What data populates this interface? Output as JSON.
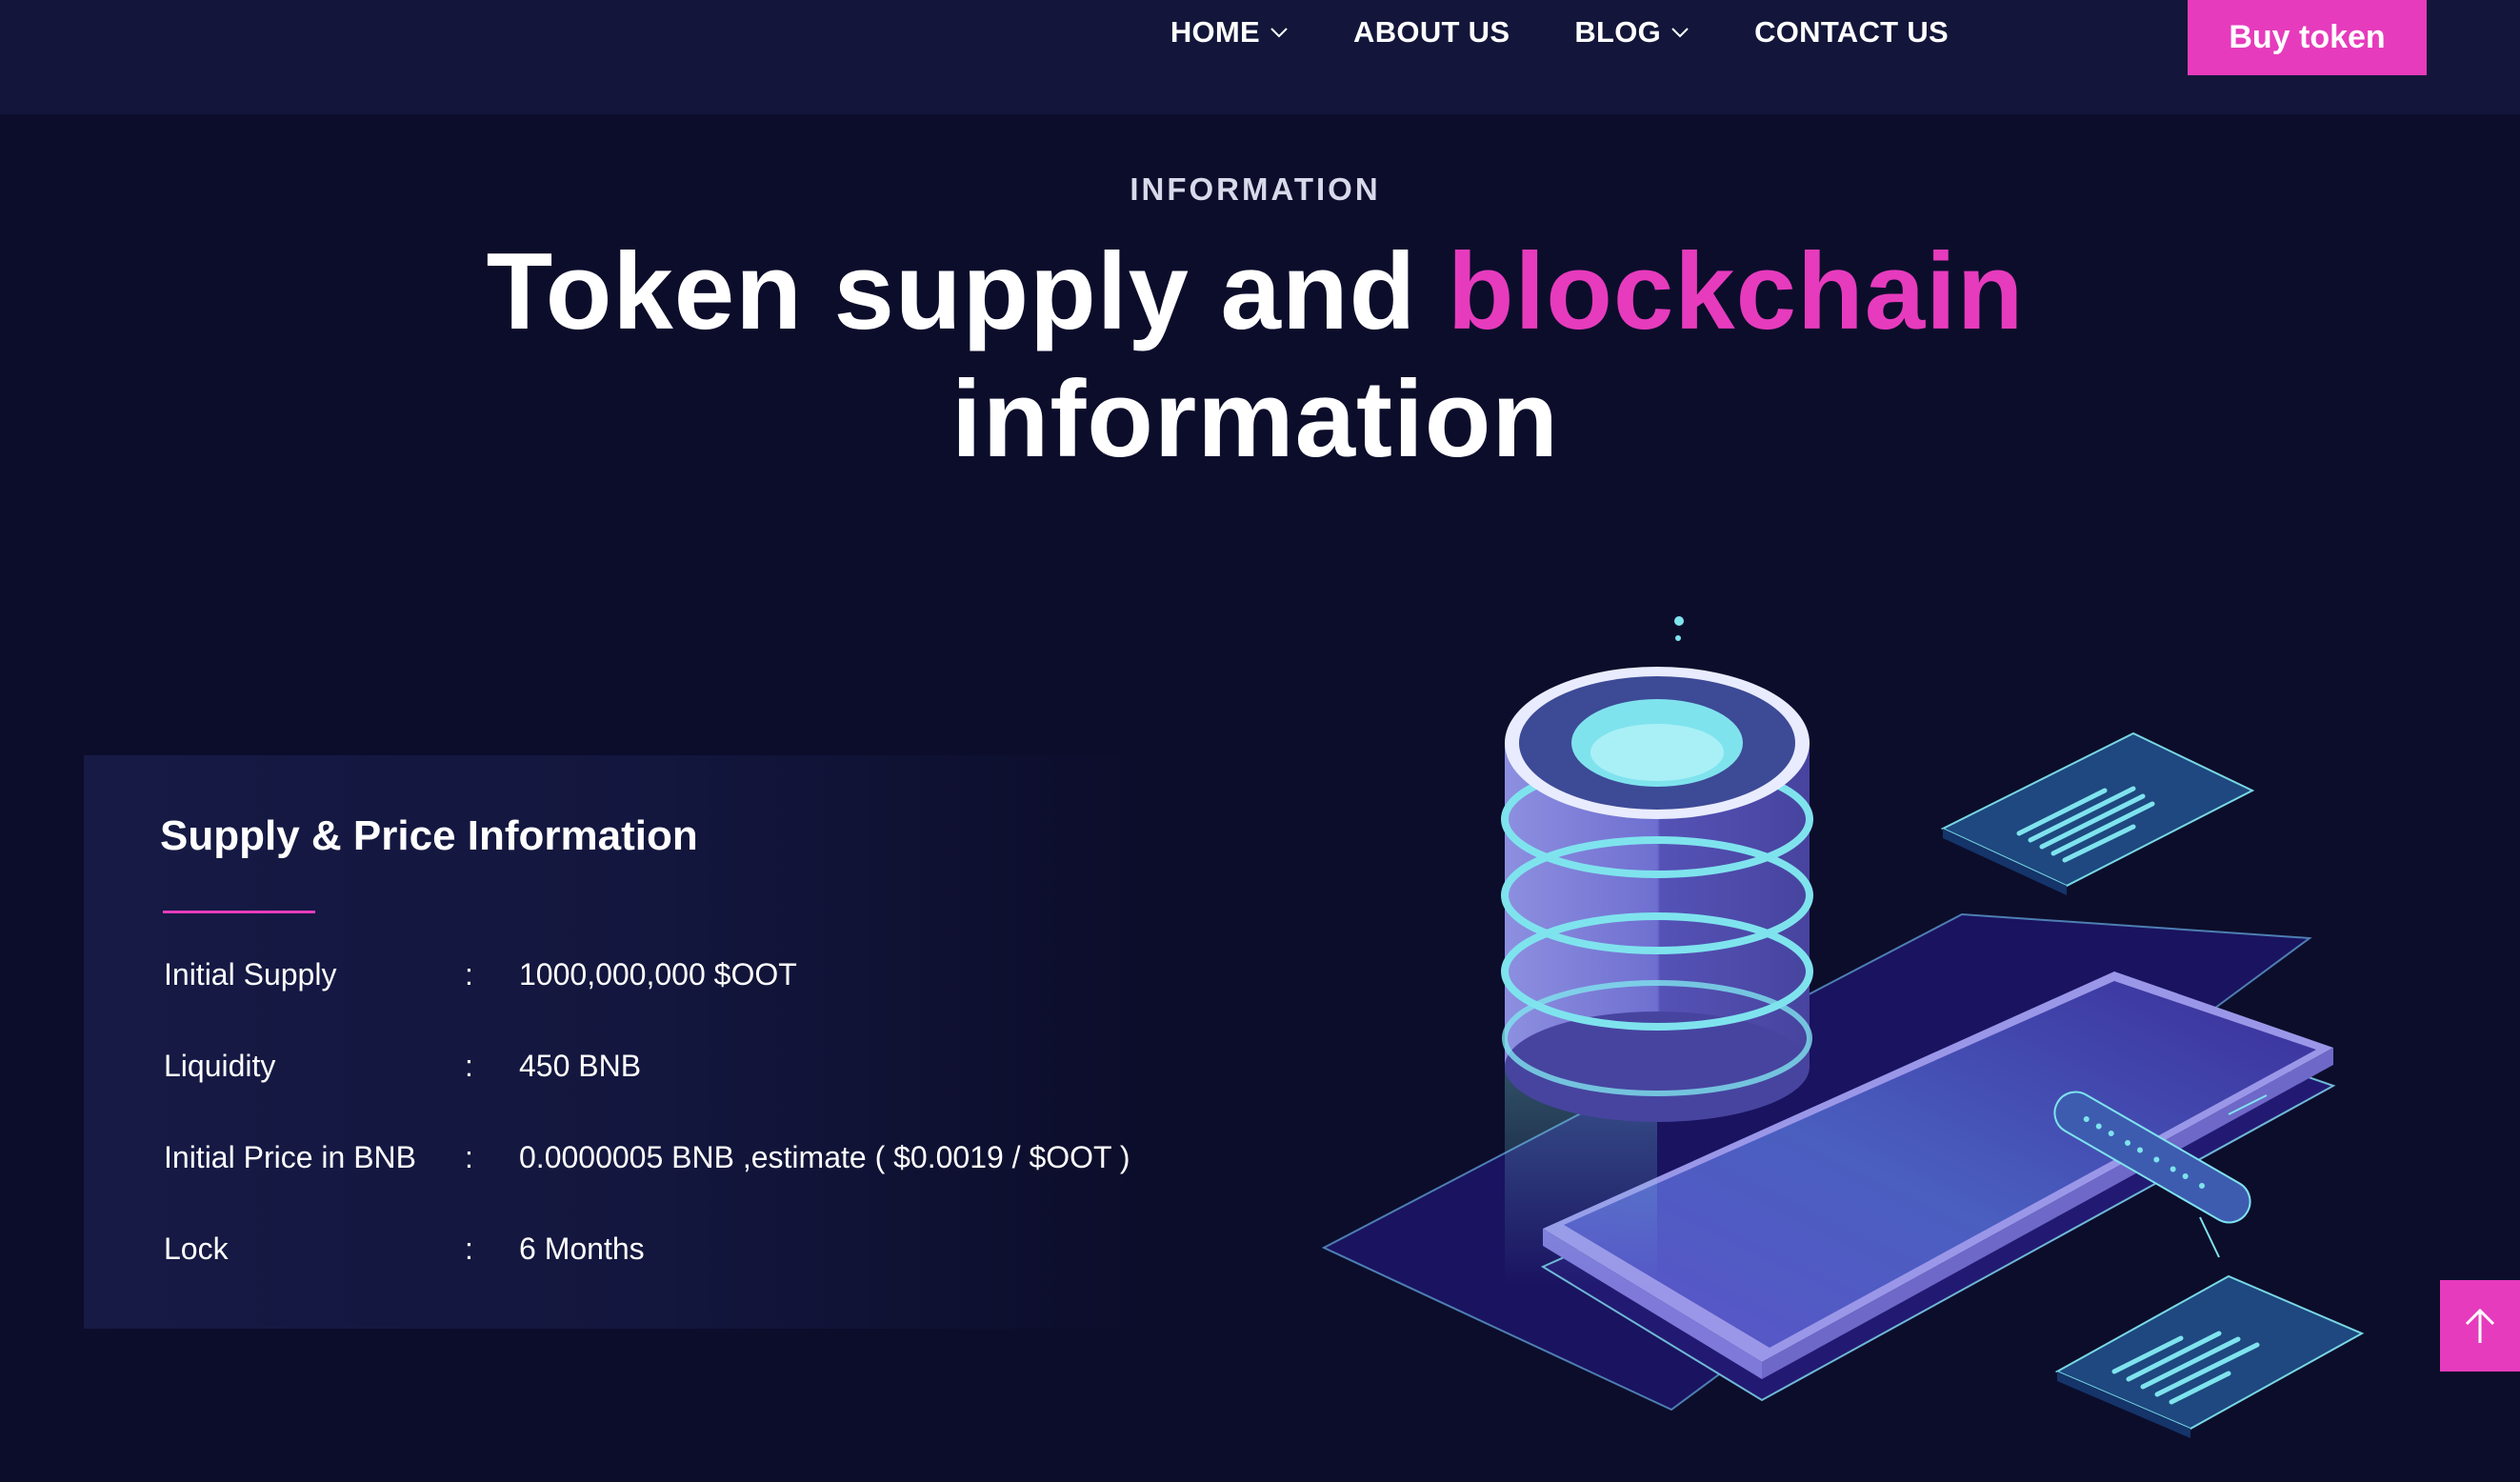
{
  "header": {
    "nav": [
      {
        "label": "HOME",
        "has_dropdown": true
      },
      {
        "label": "ABOUT US",
        "has_dropdown": false
      },
      {
        "label": "BLOG",
        "has_dropdown": true
      },
      {
        "label": "CONTACT US",
        "has_dropdown": false
      }
    ],
    "cta_label": "Buy token"
  },
  "section": {
    "kicker": "INFORMATION",
    "title_part1": "Token supply and ",
    "title_accent": "blockchain",
    "title_part2": "information"
  },
  "card": {
    "title": "Supply & Price Information",
    "rows": [
      {
        "label": "Initial Supply",
        "separator": ":",
        "value": "1000,000,000 $OOT"
      },
      {
        "label": "Liquidity",
        "separator": ":",
        "value": "450 BNB"
      },
      {
        "label": "Initial Price in BNB",
        "separator": ":",
        "value": "0.0000005 BNB ,estimate ( $0.0019 / $OOT )"
      },
      {
        "label": "Lock",
        "separator": ":",
        "value": "6 Months"
      }
    ]
  },
  "icons": {
    "chevron": "chevron-down-icon",
    "back_to_top": "arrow-up-icon",
    "illustration": "database-phone-illustration"
  },
  "colors": {
    "background": "#0c0d2b",
    "header": "#13163a",
    "accent": "#e63bbd",
    "card": "#161a45"
  }
}
